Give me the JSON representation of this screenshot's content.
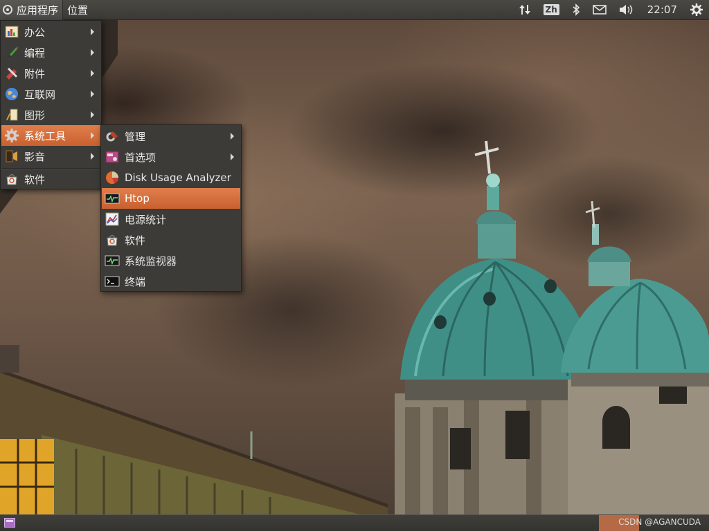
{
  "top_panel": {
    "applications_label": "应用程序",
    "places_label": "位置",
    "tray": {
      "network_icon": "network-updown-icon",
      "input_method": "Zh",
      "bluetooth_icon": "bluetooth-icon",
      "mail_icon": "mail-icon",
      "volume_icon": "volume-icon",
      "clock": "22:07",
      "session_icon": "gear-icon"
    }
  },
  "main_menu": {
    "items": [
      {
        "label": "办公",
        "icon": "office-icon",
        "has_submenu": true
      },
      {
        "label": "编程",
        "icon": "programming-icon",
        "has_submenu": true
      },
      {
        "label": "附件",
        "icon": "accessories-icon",
        "has_submenu": true
      },
      {
        "label": "互联网",
        "icon": "internet-globe-icon",
        "has_submenu": true
      },
      {
        "label": "图形",
        "icon": "graphics-icon",
        "has_submenu": true
      },
      {
        "label": "系统工具",
        "icon": "system-tools-gear-icon",
        "has_submenu": true,
        "active": true
      },
      {
        "label": "影音",
        "icon": "multimedia-icon",
        "has_submenu": true
      },
      {
        "label": "软件",
        "icon": "software-center-icon",
        "has_submenu": false
      }
    ]
  },
  "system_tools_submenu": {
    "items": [
      {
        "label": "管理",
        "icon": "administration-icon",
        "has_submenu": true
      },
      {
        "label": "首选项",
        "icon": "preferences-icon",
        "has_submenu": true
      },
      {
        "label": "Disk Usage Analyzer",
        "icon": "disk-usage-pie-icon",
        "has_submenu": false
      },
      {
        "label": "Htop",
        "icon": "htop-monitor-icon",
        "has_submenu": false,
        "active": true
      },
      {
        "label": "电源统计",
        "icon": "power-statistics-icon",
        "has_submenu": false
      },
      {
        "label": "软件",
        "icon": "software-center-icon",
        "has_submenu": false
      },
      {
        "label": "系统监视器",
        "icon": "system-monitor-icon",
        "has_submenu": false
      },
      {
        "label": "终端",
        "icon": "terminal-icon",
        "has_submenu": false
      }
    ]
  },
  "bottom_panel": {
    "show_desktop_icon": "show-desktop-icon",
    "watermark": "CSDN @AGANCUDA"
  },
  "colors": {
    "menu_bg": "#3c3b37",
    "highlight": "#d96f3d",
    "panel": "#3c3b37"
  }
}
